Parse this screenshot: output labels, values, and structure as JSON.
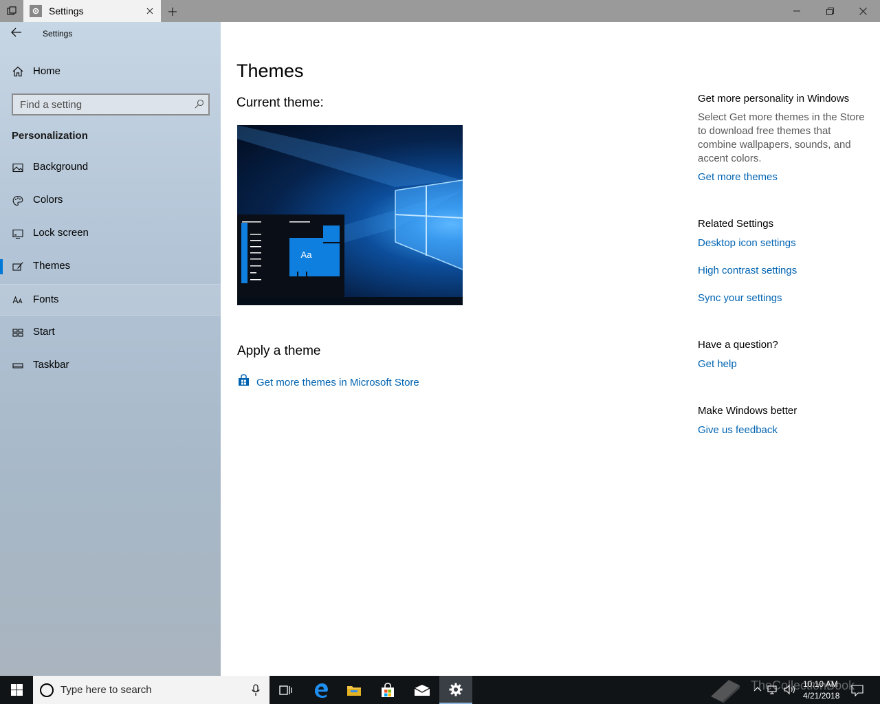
{
  "titlebar": {
    "tab_title": "Settings",
    "icons": [
      "task-view-icon",
      "gear-icon",
      "close-icon",
      "plus-icon",
      "minimize-icon",
      "restore-icon",
      "close-window-icon"
    ]
  },
  "sidebar": {
    "app_title": "Settings",
    "home_label": "Home",
    "search_placeholder": "Find a setting",
    "section_label": "Personalization",
    "items": [
      {
        "label": "Background",
        "icon": "picture-icon"
      },
      {
        "label": "Colors",
        "icon": "palette-icon"
      },
      {
        "label": "Lock screen",
        "icon": "lock-screen-icon"
      },
      {
        "label": "Themes",
        "icon": "brush-icon",
        "selected": true
      },
      {
        "label": "Fonts",
        "icon": "font-icon",
        "hover": true
      },
      {
        "label": "Start",
        "icon": "start-icon"
      },
      {
        "label": "Taskbar",
        "icon": "taskbar-icon"
      }
    ]
  },
  "main": {
    "title": "Themes",
    "current_theme_label": "Current theme:",
    "preview_tile_text": "Aa",
    "apply_title": "Apply a theme",
    "store_link": "Get more themes in Microsoft Store"
  },
  "right": {
    "personality_head": "Get more personality in Windows",
    "personality_desc": "Select Get more themes in the Store to download free themes that combine wallpapers, sounds, and accent colors.",
    "get_more_themes": "Get more themes",
    "related_head": "Related Settings",
    "desktop_icon": "Desktop icon settings",
    "high_contrast": "High contrast settings",
    "sync": "Sync your settings",
    "question_head": "Have a question?",
    "get_help": "Get help",
    "better_head": "Make Windows better",
    "feedback": "Give us feedback"
  },
  "taskbar": {
    "search_text": "Type here to search",
    "watermark": "TheCollectionBook",
    "time": "10:10 AM",
    "date": "4/21/2018",
    "apps": [
      "task-view-icon",
      "edge-icon",
      "file-explorer-icon",
      "store-icon",
      "mail-icon",
      "settings-icon"
    ]
  },
  "colors": {
    "accent": "#0078d7",
    "link": "#0063b1"
  }
}
